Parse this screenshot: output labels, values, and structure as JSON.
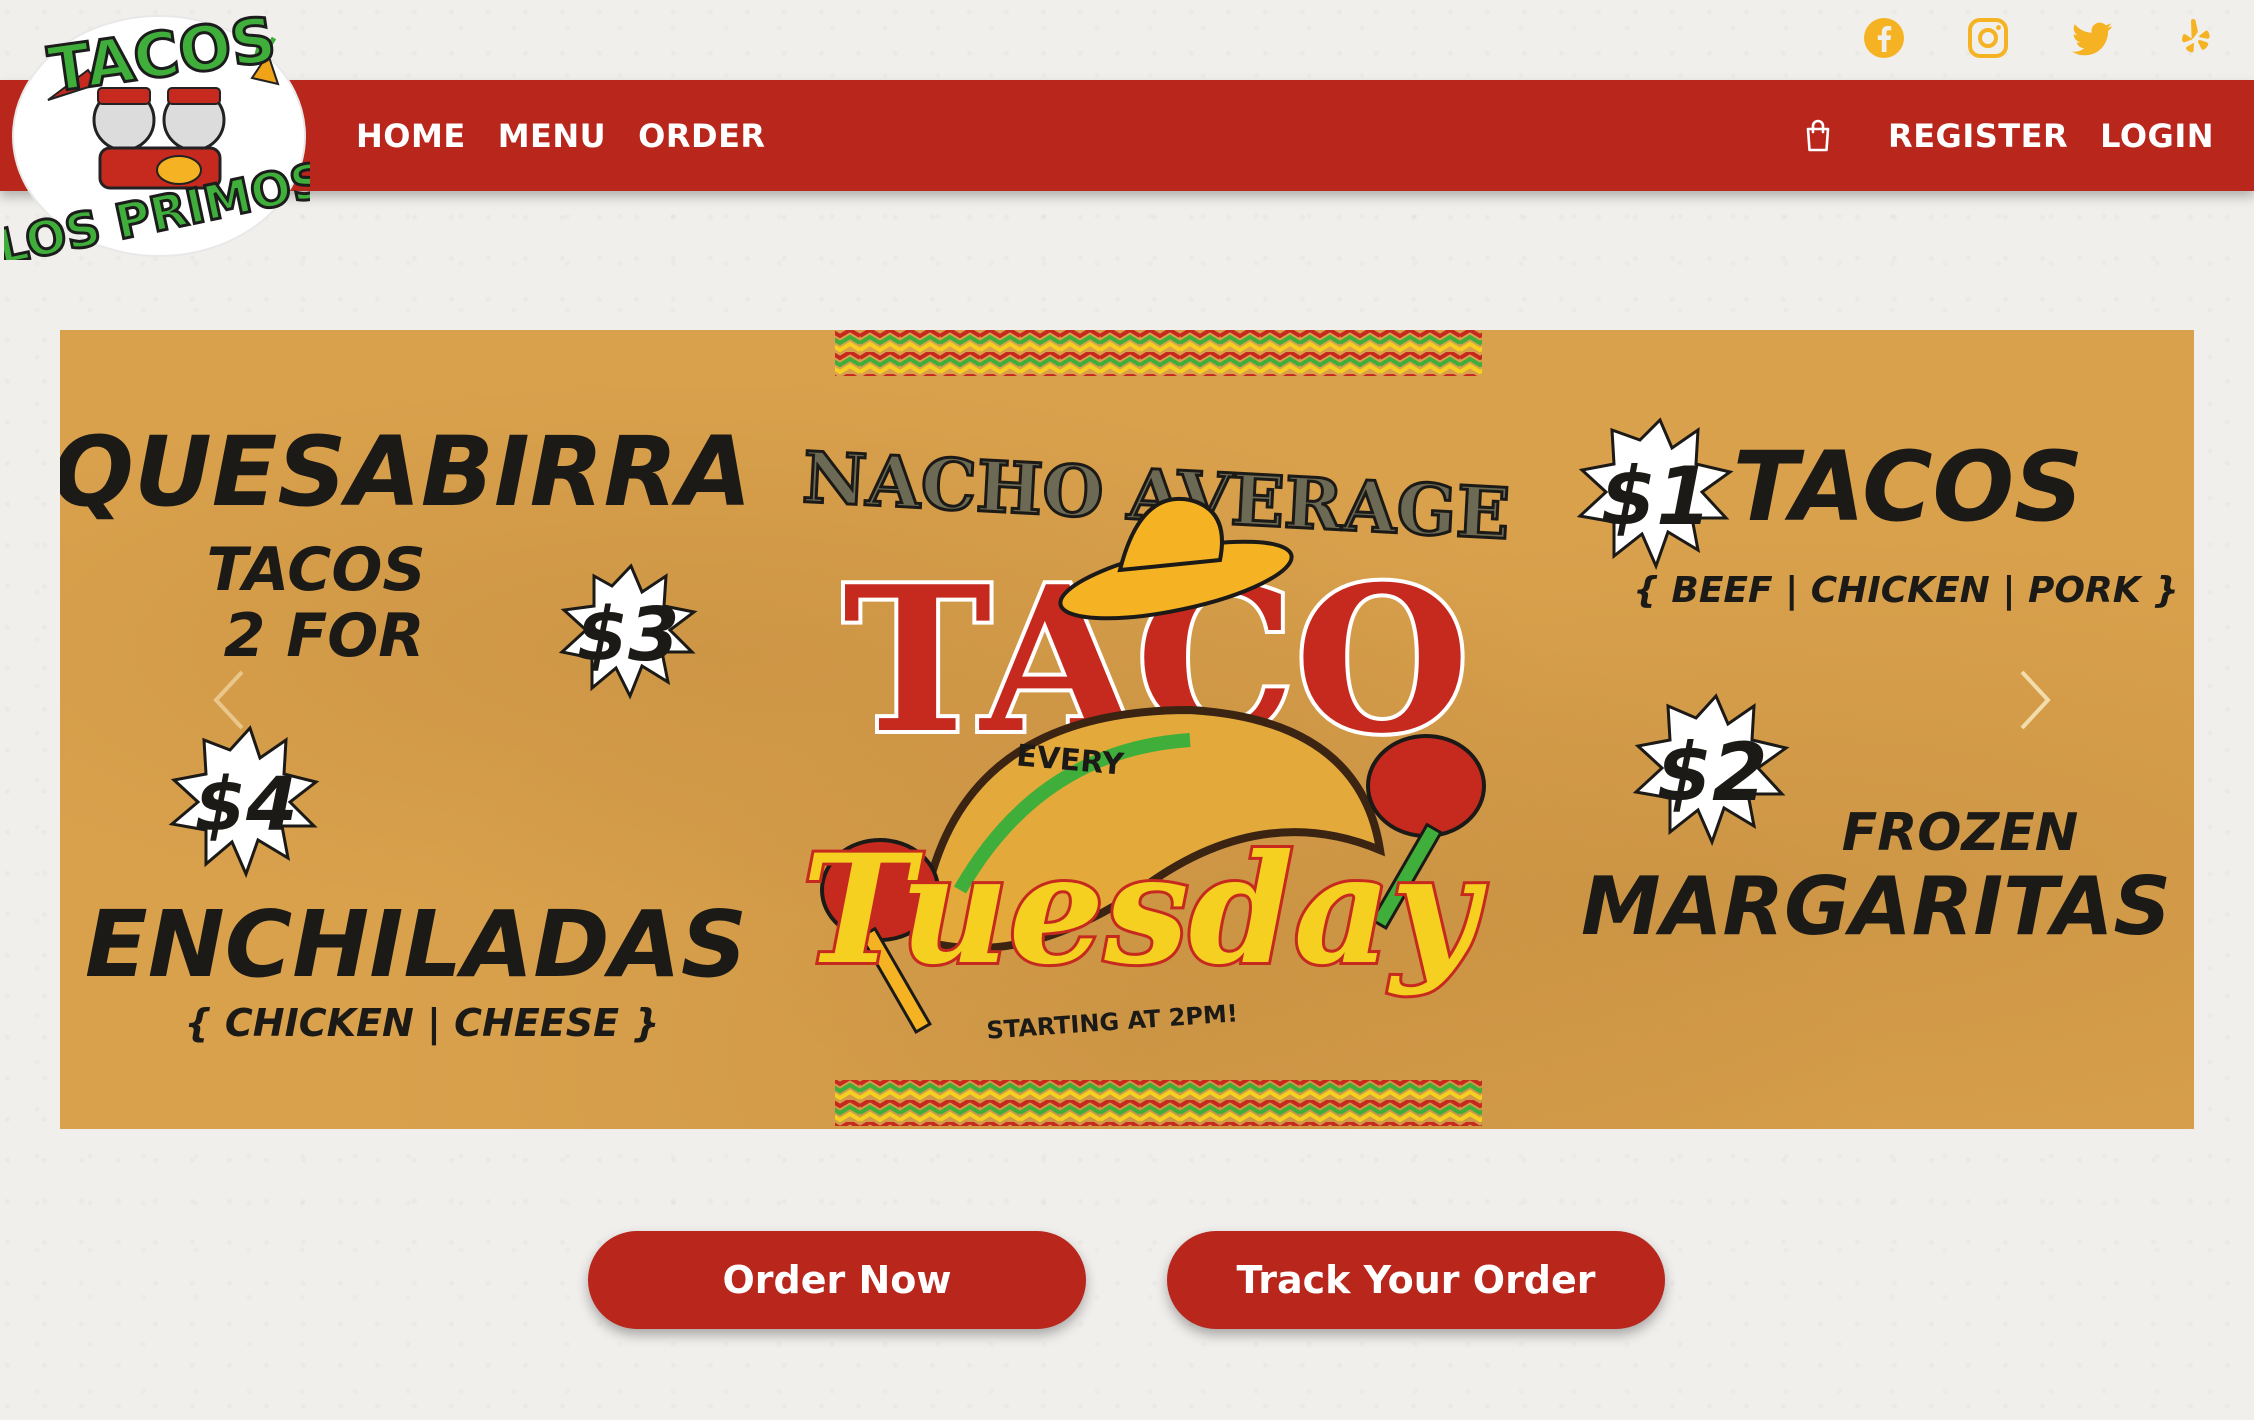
{
  "brand": {
    "logo_text_top": "TACOS",
    "logo_text_bottom": "LOS PRIMOS",
    "accent_red": "#b8261c",
    "accent_gold": "#f5b323",
    "logo_green": "#3fae3a"
  },
  "social": [
    "facebook-icon",
    "instagram-icon",
    "twitter-icon",
    "yelp-icon"
  ],
  "nav": {
    "home": "HOME",
    "menu": "MENU",
    "order": "ORDER",
    "register": "REGISTER",
    "login": "LOGIN"
  },
  "banner": {
    "left": {
      "quesabirra": "QUESABIRRA",
      "tacos": "TACOS",
      "two_for": "2 FOR",
      "price3": "$3",
      "price4": "$4",
      "enchiladas": "ENCHILADAS",
      "enchilada_options": "{ CHICKEN | CHEESE }"
    },
    "center": {
      "nacho_average": "NACHO AVERAGE",
      "taco": "TACO",
      "every": "EVERY",
      "tuesday": "Tuesday",
      "starting": "STARTING AT 2PM!"
    },
    "right": {
      "price1": "$1",
      "tacos": "TACOS",
      "taco_options": "{ BEEF | CHICKEN | PORK }",
      "price2": "$2",
      "frozen": "FROZEN",
      "margaritas": "MARGARITAS"
    }
  },
  "actions": {
    "order_now": "Order Now",
    "track_order": "Track Your Order"
  }
}
